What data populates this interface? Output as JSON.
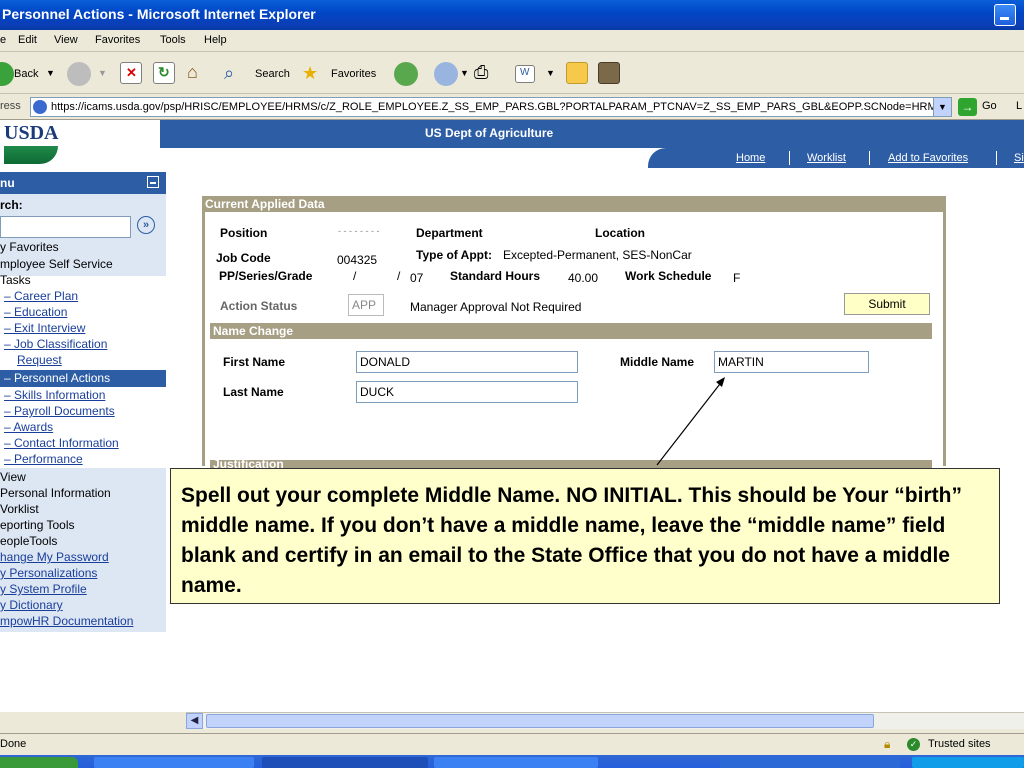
{
  "window": {
    "title": "Personnel Actions - Microsoft Internet Explorer"
  },
  "menubar": {
    "items": [
      "e",
      "Edit",
      "View",
      "Favorites",
      "Tools",
      "Help"
    ]
  },
  "toolbar": {
    "back": "Back",
    "search": "Search",
    "favorites": "Favorites"
  },
  "address": {
    "label": "ress",
    "url": "https://icams.usda.gov/psp/HRISC/EMPLOYEE/HRMS/c/Z_ROLE_EMPLOYEE.Z_SS_EMP_PARS.GBL?PORTALPARAM_PTCNAV=Z_SS_EMP_PARS_GBL&EOPP.SCNode=HRMS&",
    "go": "Go",
    "links": "L"
  },
  "header": {
    "logo": "USDA",
    "org": "US Dept of Agriculture",
    "links": [
      "Home",
      "Worklist",
      "Add to Favorites",
      "Si"
    ]
  },
  "menu": {
    "title": "nu",
    "search_label": "rch:",
    "items": [
      {
        "label": "y Favorites",
        "link": false
      },
      {
        "label": "mployee Self Service",
        "link": false
      },
      {
        "label": " Tasks",
        "link": false
      },
      {
        "label": "– Career Plan",
        "link": true
      },
      {
        "label": "– Education",
        "link": true
      },
      {
        "label": "– Exit Interview",
        "link": true
      },
      {
        "label": "– Job Classification",
        "link": true
      },
      {
        "label": "Request",
        "link": true
      },
      {
        "label": "– Personnel Actions",
        "link": false
      },
      {
        "label": "– Skills Information",
        "link": true
      },
      {
        "label": "– Payroll Documents",
        "link": true
      },
      {
        "label": "– Awards",
        "link": true
      },
      {
        "label": "– Contact Information",
        "link": true
      },
      {
        "label": "– Performance",
        "link": true
      },
      {
        "label": " View",
        "link": false
      },
      {
        "label": " Personal Information",
        "link": false
      },
      {
        "label": "Vorklist",
        "link": false
      },
      {
        "label": "eporting Tools",
        "link": false
      },
      {
        "label": "eopleTools",
        "link": false
      },
      {
        "label": "hange My Password",
        "link": true
      },
      {
        "label": "y Personalizations",
        "link": true
      },
      {
        "label": "y System Profile",
        "link": true
      },
      {
        "label": "y Dictionary",
        "link": true
      },
      {
        "label": "mpowHR Documentation",
        "link": true
      }
    ]
  },
  "current": {
    "header": "Current Applied Data",
    "position_label": "Position",
    "position_value": "- - - - - - - -",
    "department_label": "Department",
    "location_label": "Location",
    "job_code_label": "Job Code",
    "job_code_value": "004325",
    "type_appt_label": "Type of Appt:",
    "type_appt_value": "Excepted-Permanent, SES-NonCar",
    "pp_label": "PP/Series/Grade",
    "pp_sep1": "/",
    "pp_sep2": "/",
    "pp_grade": "07",
    "std_hours_label": "Standard Hours",
    "std_hours_value": "40.00",
    "work_sched_label": "Work Schedule",
    "work_sched_value": "F",
    "action_status_label": "Action Status",
    "action_status_value": "APP",
    "approval_text": "Manager Approval Not Required",
    "submit": "Submit"
  },
  "name_change": {
    "header": "Name Change",
    "first_name_label": "First Name",
    "first_name_value": "DONALD",
    "middle_name_label": "Middle Name",
    "middle_name_value": "MARTIN",
    "last_name_label": "Last Name",
    "last_name_value": "DUCK",
    "next_section": "Justification"
  },
  "callout": {
    "text": "Spell out your complete Middle Name.  NO INITIAL. This should be Your “birth” middle name. If you don’t have a middle name, leave the “middle name” field blank and certify in an email to the State Office that you do not have a middle name."
  },
  "statusbar": {
    "left": "Done",
    "zone": "Trusted sites"
  }
}
